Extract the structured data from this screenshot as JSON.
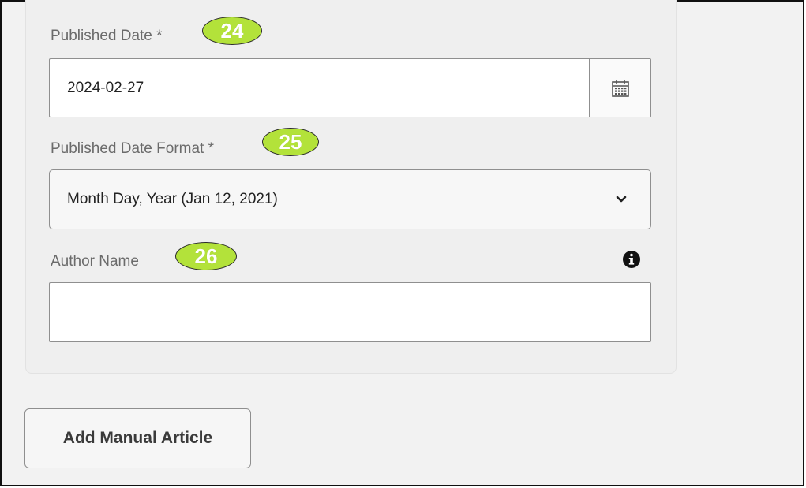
{
  "form": {
    "published_date": {
      "label": "Published Date *",
      "value": "2024-02-27",
      "badge": "24",
      "calendar_icon": "calendar-icon"
    },
    "published_date_format": {
      "label": "Published Date Format *",
      "selected": "Month Day, Year (Jan 12, 2021)",
      "badge": "25",
      "chevron_icon": "chevron-down-icon"
    },
    "author_name": {
      "label": "Author Name",
      "value": "",
      "badge": "26",
      "info_icon": "info-icon"
    }
  },
  "actions": {
    "add_manual_article_label": "Add Manual Article"
  },
  "colors": {
    "badge": "#b3e23a",
    "panel_bg": "#efefef",
    "page_bg": "#f2f2f2",
    "border": "#8f8f8f"
  }
}
